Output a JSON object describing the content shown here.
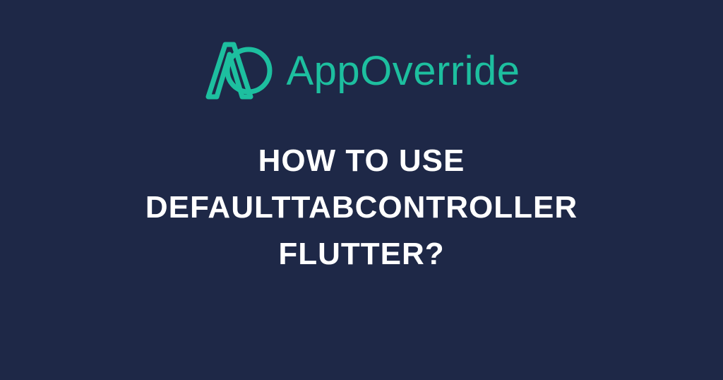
{
  "brand": {
    "name": "AppOverride",
    "accentColor": "#1dbf9f"
  },
  "heading": {
    "line1": "How to use",
    "line2": "DefaultTabController",
    "line3": "Flutter?"
  }
}
